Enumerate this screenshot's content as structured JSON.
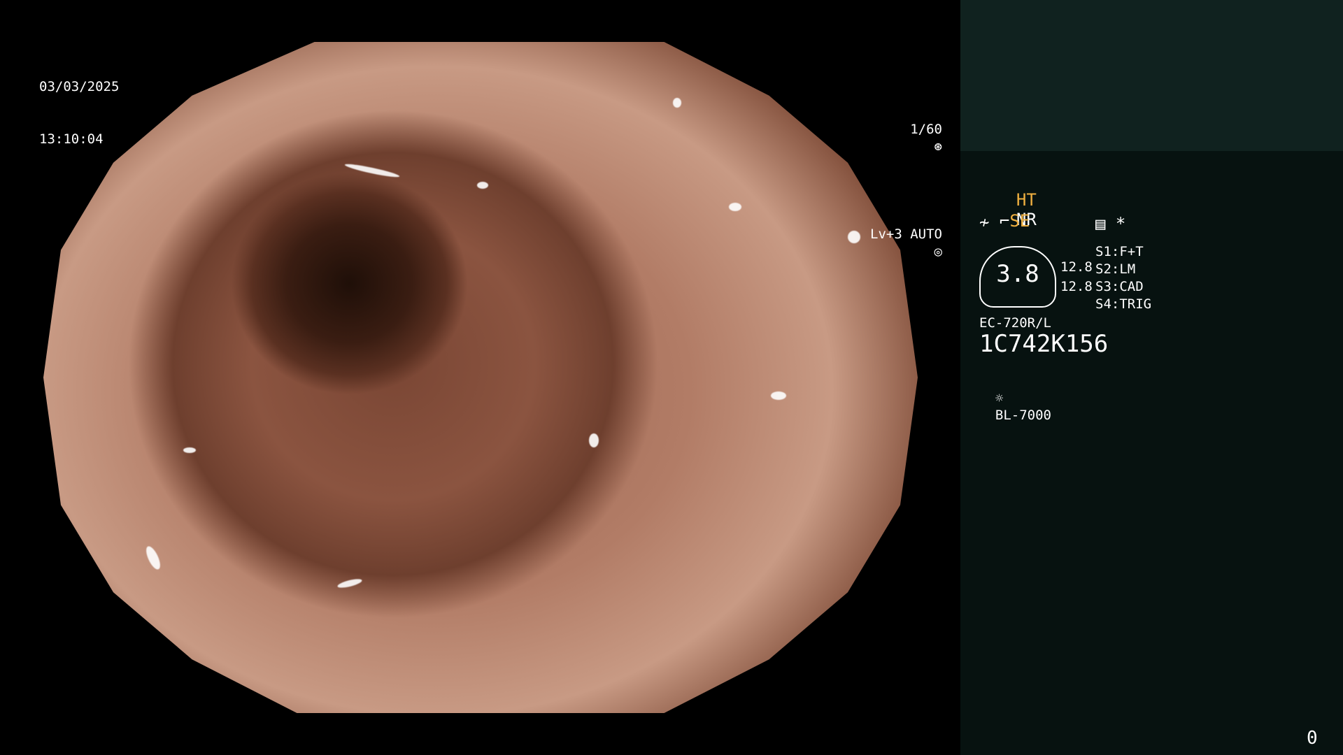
{
  "overlay": {
    "date": "03/03/2025",
    "time": "13:10:04",
    "shutter": "1/60",
    "level": "Lv+3 AUTO"
  },
  "panel": {
    "ht": "HT",
    "nr": "NR",
    "se": "SE",
    "gauge_value": "3.8",
    "value_1": "12.8",
    "value_2": "12.8",
    "s1": "F+T",
    "s2": "LM",
    "s3": "CAD",
    "s4": "TRIG",
    "s1_label": "S1:",
    "s2_label": "S2:",
    "s3_label": "S3:",
    "s4_label": "S4:",
    "scope_model": "EC-720R/L",
    "serial": "1C742K156",
    "light_source": "BL-7000",
    "frame_count": "0"
  },
  "icons": [
    "shutter-icon",
    "auto-iris-icon",
    "structure-enhance-icon",
    "color-enhance-icon",
    "menu-icon",
    "light-source-icon"
  ]
}
